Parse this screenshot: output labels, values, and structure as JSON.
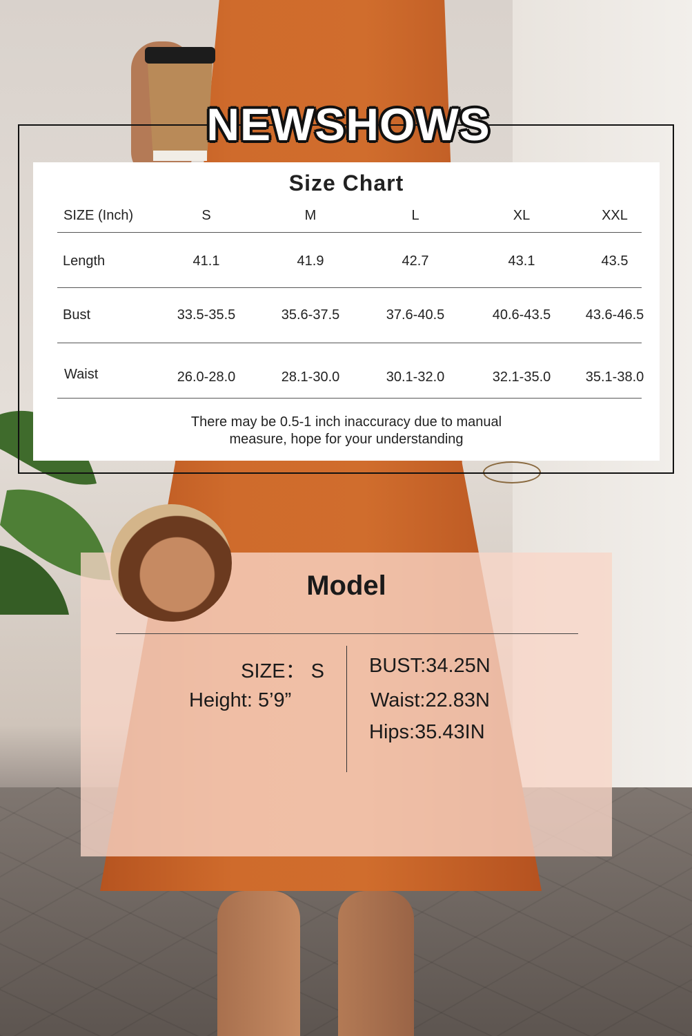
{
  "brand": "NEWSHOWS",
  "size_chart": {
    "title": "Size Chart",
    "header": [
      "SIZE (Inch)",
      "S",
      "M",
      "L",
      "XL",
      "XXL"
    ],
    "rows": [
      {
        "label": "Length",
        "values": [
          "41.1",
          "41.9",
          "42.7",
          "43.1",
          "43.5"
        ]
      },
      {
        "label": "Bust",
        "values": [
          "33.5-35.5",
          "35.6-37.5",
          "37.6-40.5",
          "40.6-43.5",
          "43.6-46.5"
        ]
      },
      {
        "label": "Waist",
        "values": [
          "26.0-28.0",
          "28.1-30.0",
          "30.1-32.0",
          "32.1-35.0",
          "35.1-38.0"
        ]
      }
    ],
    "note_line1": "There may be 0.5-1 inch inaccuracy due to manual",
    "note_line2": "measure, hope for your understanding"
  },
  "model": {
    "title": "Model",
    "size": "SIZE： S",
    "height": "Height: 5’9”",
    "bust": "BUST:34.25N",
    "waist": "Waist:22.83N",
    "hips": "Hips:35.43IN"
  }
}
